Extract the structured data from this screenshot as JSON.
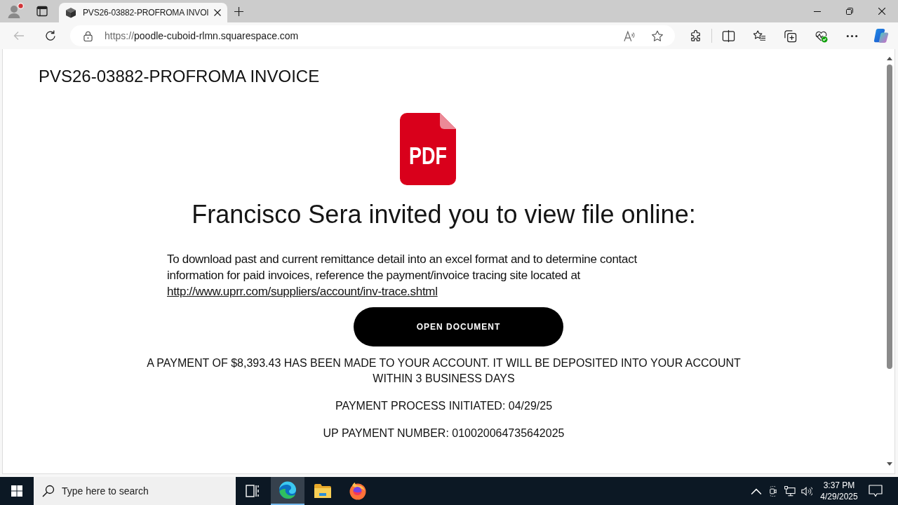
{
  "browser": {
    "tabs": [
      {
        "title": "PVS26-03882-PROFROMA INVOI",
        "selected": true
      }
    ],
    "back_button": {
      "disabled": true
    },
    "address": {
      "scheme": "https://",
      "host": "poodle-cuboid-rlmn.squarespace.com"
    }
  },
  "page": {
    "title": "PVS26-03882-PROFROMA INVOICE",
    "file_icon_label": "PDF",
    "heading": "Francisco Sera invited you to view file online:",
    "paragraph": {
      "text": "To download past and current remittance detail into an excel format and to determine contact information for paid invoices, reference the payment/invoice tracing site located at",
      "link": "http://www.uprr.com/suppliers/account/inv-trace.shtml"
    },
    "button": "OPEN DOCUMENT",
    "notices": [
      "A PAYMENT OF $8,393.43 HAS BEEN MADE TO YOUR ACCOUNT. IT WILL BE DEPOSITED INTO YOUR ACCOUNT WITHIN 3 BUSINESS DAYS",
      "PAYMENT PROCESS INITIATED: 04/29/25",
      "UP PAYMENT NUMBER: 010020064735642025"
    ]
  },
  "taskbar": {
    "search": {
      "placeholder": "Type here to search"
    },
    "apps": [
      {
        "active": false
      },
      {
        "active": true
      },
      {
        "active": false
      },
      {
        "active": false
      }
    ],
    "clock": {
      "time": "3:37 PM",
      "date": "4/29/2025"
    }
  }
}
